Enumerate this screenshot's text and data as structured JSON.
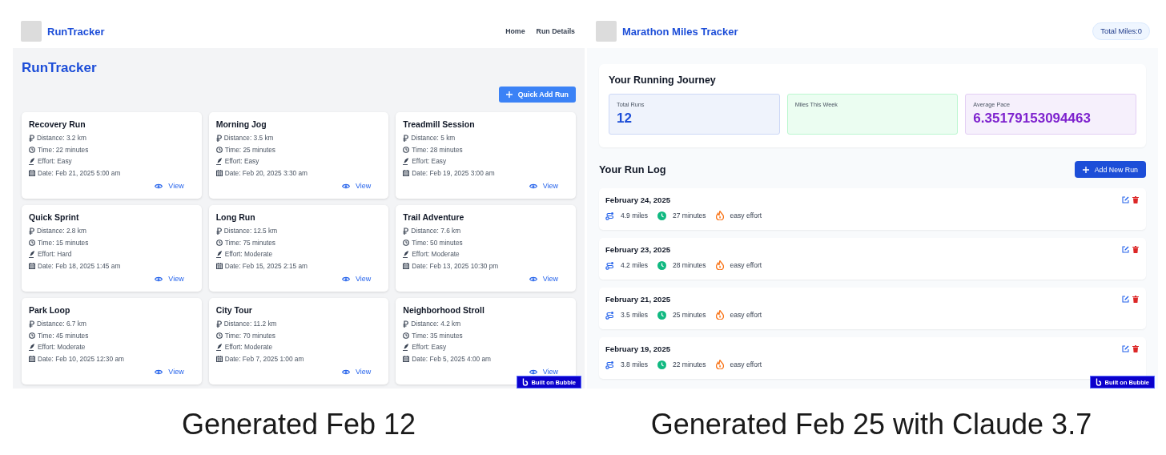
{
  "panels": [
    {
      "kind": "cards",
      "header": {
        "brand": "RunTracker",
        "nav": [
          "Home",
          "Run Details"
        ]
      },
      "heading": "RunTracker",
      "add_button": "Quick Add Run",
      "runs": [
        {
          "name": "Recovery Run",
          "distance": "Distance: 3.2 km",
          "time": "Time: 22 minutes",
          "effort": "Effort: Easy",
          "date": "Date: Feb 21, 2025 5:00 am",
          "action": "View"
        },
        {
          "name": "Morning Jog",
          "distance": "Distance: 3.5 km",
          "time": "Time: 25 minutes",
          "effort": "Effort: Easy",
          "date": "Date: Feb 20, 2025 3:30 am",
          "action": "View"
        },
        {
          "name": "Treadmill Session",
          "distance": "Distance: 5 km",
          "time": "Time: 28 minutes",
          "effort": "Effort: Easy",
          "date": "Date: Feb 19, 2025 3:00 am",
          "action": "View"
        },
        {
          "name": "Quick Sprint",
          "distance": "Distance: 2.8 km",
          "time": "Time: 15 minutes",
          "effort": "Effort: Hard",
          "date": "Date: Feb 18, 2025 1:45 am",
          "action": "View"
        },
        {
          "name": "Long Run",
          "distance": "Distance: 12.5 km",
          "time": "Time: 75 minutes",
          "effort": "Effort: Moderate",
          "date": "Date: Feb 15, 2025 2:15 am",
          "action": "View"
        },
        {
          "name": "Trail Adventure",
          "distance": "Distance: 7.6 km",
          "time": "Time: 50 minutes",
          "effort": "Effort: Moderate",
          "date": "Date: Feb 13, 2025 10:30 pm",
          "action": "View"
        },
        {
          "name": "Park Loop",
          "distance": "Distance: 6.7 km",
          "time": "Time: 45 minutes",
          "effort": "Effort: Moderate",
          "date": "Date: Feb 10, 2025 12:30 am",
          "action": "View"
        },
        {
          "name": "City Tour",
          "distance": "Distance: 11.2 km",
          "time": "Time: 70 minutes",
          "effort": "Effort: Moderate",
          "date": "Date: Feb 7, 2025 1:00 am",
          "action": "View"
        },
        {
          "name": "Neighborhood Stroll",
          "distance": "Distance: 4.2 km",
          "time": "Time: 35 minutes",
          "effort": "Effort: Easy",
          "date": "Date: Feb 5, 2025 4:00 am",
          "action": "View"
        }
      ],
      "badge": "Built on Bubble"
    },
    {
      "kind": "log",
      "header": {
        "brand": "Marathon Miles Tracker",
        "total": "Total Miles:0"
      },
      "journey": {
        "title": "Your Running Journey",
        "stats": [
          {
            "label": "Total Runs",
            "value": "12",
            "color": "#1d4ed8"
          },
          {
            "label": "Miles This Week",
            "color": "#bbf7d0"
          },
          {
            "label": "Average Pace",
            "value": "6.35179153094463",
            "color": "#7e22ce"
          }
        ]
      },
      "log_title": "Your Run Log",
      "add_button": "Add New Run",
      "entries": [
        {
          "date": "February 24, 2025",
          "distance": "4.9 miles",
          "duration": "27 minutes",
          "effort": "easy effort"
        },
        {
          "date": "February 23, 2025",
          "distance": "4.2 miles",
          "duration": "28 minutes",
          "effort": "easy effort"
        },
        {
          "date": "February 21, 2025",
          "distance": "3.5 miles",
          "duration": "25 minutes",
          "effort": "easy effort"
        },
        {
          "date": "February 19, 2025",
          "distance": "3.8 miles",
          "duration": "22 minutes",
          "effort": "easy effort"
        }
      ],
      "badge": "Built on Bubble"
    }
  ],
  "captions": [
    "Generated Feb 12",
    "Generated Feb 25 with Claude 3.7"
  ]
}
